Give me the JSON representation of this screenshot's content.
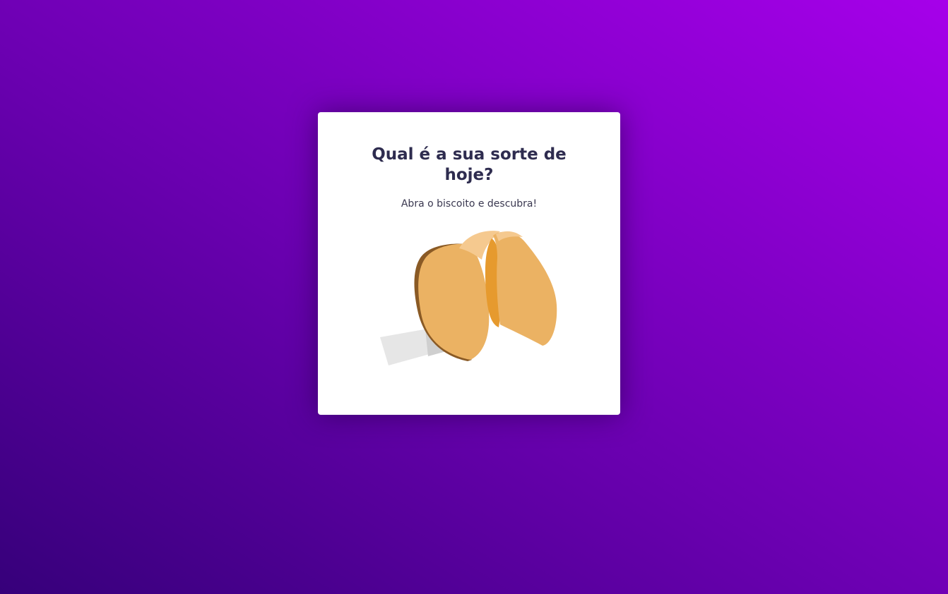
{
  "card": {
    "title": "Qual é a sua sorte de hoje?",
    "subtitle": "Abra o biscoito e descubra!"
  },
  "cookie": {
    "icon": "fortune-cookie-icon"
  },
  "colors": {
    "background_start": "#36007a",
    "background_end": "#a600ea",
    "title": "#2e2c4f",
    "cookie": "#ebb263",
    "cookie_shadow": "#e69a2e",
    "paper": "#e6e6e6"
  }
}
